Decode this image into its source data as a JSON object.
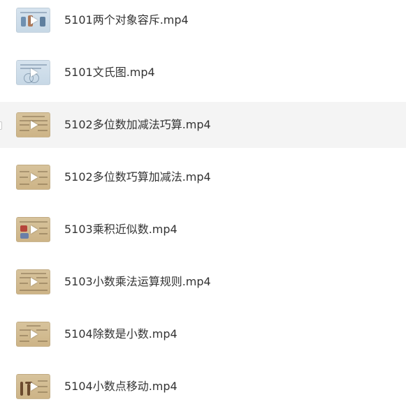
{
  "files": [
    {
      "name": "5101两个对象容斥.mp4",
      "thumb_style": "blue",
      "icon": "play-icon"
    },
    {
      "name": "5101文氏图.mp4",
      "thumb_style": "blue",
      "icon": "play-icon"
    },
    {
      "name": "5102多位数加减法巧算.mp4",
      "thumb_style": "tan",
      "icon": "play-icon",
      "selected": true
    },
    {
      "name": "5102多位数巧算加减法.mp4",
      "thumb_style": "tan",
      "icon": "play-icon"
    },
    {
      "name": "5103乘积近似数.mp4",
      "thumb_style": "tan",
      "icon": "play-icon"
    },
    {
      "name": "5103小数乘法运算规则.mp4",
      "thumb_style": "tan",
      "icon": "play-icon"
    },
    {
      "name": "5104除数是小数.mp4",
      "thumb_style": "tan",
      "icon": "play-icon"
    },
    {
      "name": "5104小数点移动.mp4",
      "thumb_style": "tan",
      "icon": "play-icon"
    }
  ],
  "colors": {
    "selected_row_bg": "#f4f4f4",
    "text": "#333333",
    "thumb_blue": "#d6e3ee",
    "thumb_tan": "#d7c39c"
  }
}
